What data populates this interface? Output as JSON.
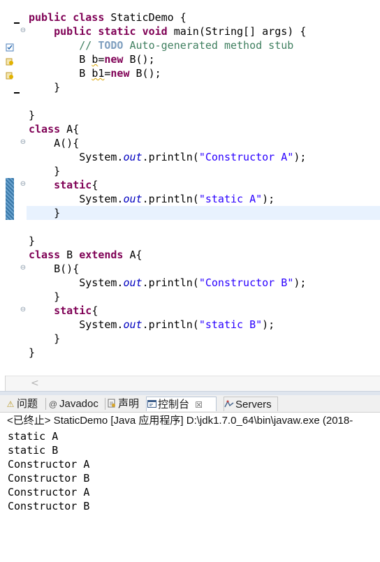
{
  "editor": {
    "lines": [
      {
        "type": "class_decl",
        "text": "public class StaticDemo {"
      },
      {
        "type": "method",
        "text": "    public static void main(String[] args) {"
      },
      {
        "type": "todo",
        "indent": "        ",
        "comment_prefix": "// ",
        "todo": "TODO",
        "comment_rest": " Auto-generated method stub"
      },
      {
        "type": "new",
        "indent": "        ",
        "cls": "B ",
        "var": "b",
        "rest": "=",
        "kw": "new",
        "tail": " B();"
      },
      {
        "type": "new",
        "indent": "        ",
        "cls": "B ",
        "var": "b1",
        "rest": "=",
        "kw": "new",
        "tail": " B();"
      },
      {
        "type": "plain",
        "text": "    }"
      },
      {
        "type": "plain",
        "text": ""
      },
      {
        "type": "plain",
        "text": "}"
      },
      {
        "type": "class_a",
        "kw": "class",
        "text": " A{"
      },
      {
        "type": "plain",
        "text": "    A(){"
      },
      {
        "type": "println",
        "indent": "        ",
        "obj": "System.",
        "fld": "out",
        "mid": ".println(",
        "str": "\"Constructor A\"",
        "end": ");"
      },
      {
        "type": "plain",
        "text": "    }"
      },
      {
        "type": "static",
        "indent": "    ",
        "kw": "static",
        "text": "{"
      },
      {
        "type": "println",
        "indent": "        ",
        "obj": "System.",
        "fld": "out",
        "mid": ".println(",
        "str": "\"static A\"",
        "end": ");"
      },
      {
        "type": "plain",
        "text": "    }",
        "active": true
      },
      {
        "type": "plain",
        "text": ""
      },
      {
        "type": "plain",
        "text": "}"
      },
      {
        "type": "class_b",
        "kw": "class",
        "mid": " B ",
        "kw2": "extends",
        "text": " A{"
      },
      {
        "type": "plain",
        "text": "    B(){"
      },
      {
        "type": "println",
        "indent": "        ",
        "obj": "System.",
        "fld": "out",
        "mid": ".println(",
        "str": "\"Constructor B\"",
        "end": ");"
      },
      {
        "type": "plain",
        "text": "    }"
      },
      {
        "type": "static",
        "indent": "    ",
        "kw": "static",
        "text": "{"
      },
      {
        "type": "println",
        "indent": "        ",
        "obj": "System.",
        "fld": "out",
        "mid": ".println(",
        "str": "\"static B\"",
        "end": ");"
      },
      {
        "type": "plain",
        "text": "    }"
      },
      {
        "type": "plain",
        "text": "}"
      }
    ],
    "scroll_left_glyph": "<"
  },
  "tabs": [
    {
      "icon": "problems-icon",
      "glyph": "⚠",
      "label": "问题"
    },
    {
      "icon": "javadoc-icon",
      "glyph": "@",
      "label": "Javadoc"
    },
    {
      "icon": "declaration-icon",
      "glyph": "📄",
      "label": "声明"
    },
    {
      "icon": "console-icon",
      "glyph": "▣",
      "label": "控制台",
      "close": "☒",
      "active": true
    },
    {
      "icon": "servers-icon",
      "glyph": "⚙",
      "label": "Servers"
    }
  ],
  "console": {
    "status": "<已终止> StaticDemo [Java 应用程序] D:\\jdk1.7.0_64\\bin\\javaw.exe  (2018-",
    "output": [
      "static A",
      "static B",
      "Constructor A",
      "Constructor B",
      "Constructor A",
      "Constructor B"
    ]
  },
  "colors": {
    "keyword": "#7f0055",
    "string": "#2a00ff",
    "field": "#0000c0",
    "comment": "#3f7f5f",
    "todo": "#7f9fbf"
  }
}
